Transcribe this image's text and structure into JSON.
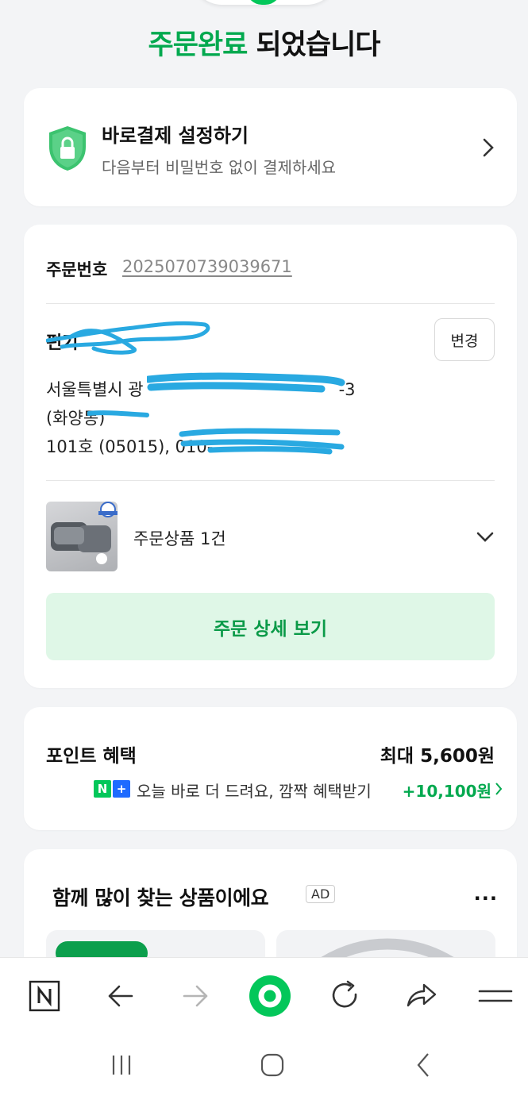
{
  "header": {
    "headline_green": "주문완료",
    "headline_rest": " 되었습니다"
  },
  "quick_pay": {
    "title": "바로결제 설정하기",
    "subtitle": "다음부터 비밀번호 없이 결제하세요",
    "icon": "shield-lock-icon"
  },
  "order": {
    "number_label": "주문번호",
    "number": "2025070739039671",
    "recipient": "편기",
    "change_label": "변경",
    "address_line1": "서울특별시 광",
    "address_line1_tail": "-3",
    "address_line2": "(화양동)",
    "address_line3": "101호 (05015), 010-",
    "product_label": "주문상품 1건",
    "detail_button": "주문 상세 보기"
  },
  "points": {
    "title": "포인트 혜택",
    "max": "최대 5,600원",
    "badge_n": "N",
    "badge_plus": "+",
    "subtitle": "오늘 바로 더 드려요, 깜짝 혜택받기",
    "bonus": "+10,100원"
  },
  "recommend": {
    "title": "함께 많이 찾는 상품이에요",
    "ad_label": "AD",
    "more_label": "···"
  },
  "colors": {
    "brand_green": "#03c75a",
    "text_green": "#03a94f",
    "button_bg": "#dff7e7",
    "scribble_blue": "#29a9e1"
  }
}
